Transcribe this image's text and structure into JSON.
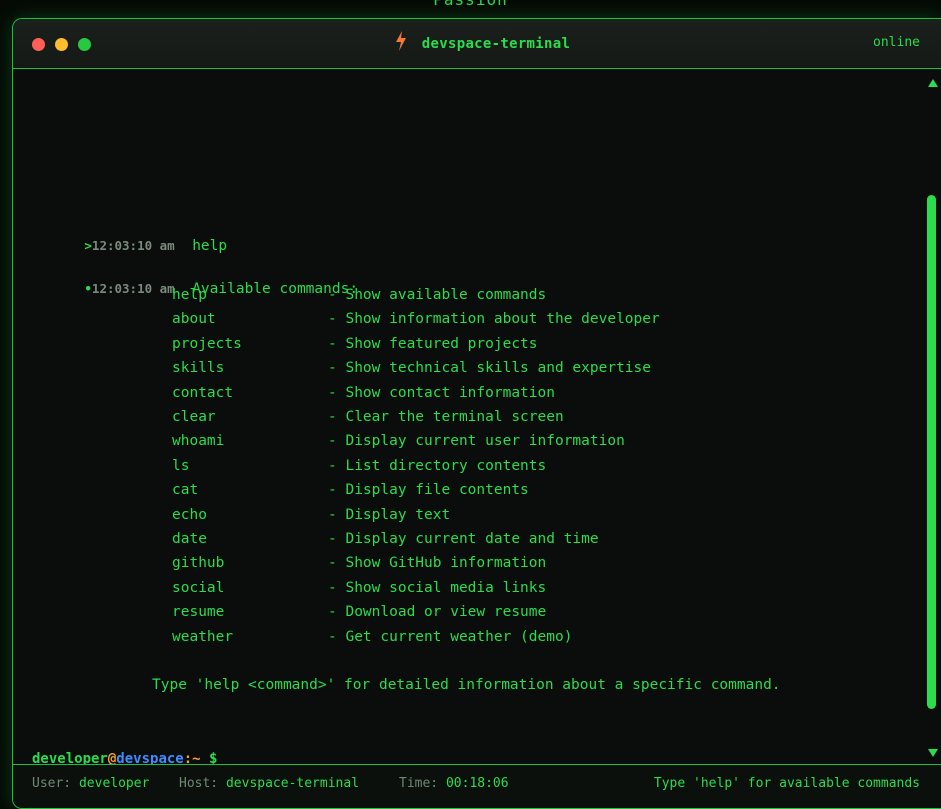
{
  "page": {
    "top_caption": "Passion"
  },
  "window": {
    "title": "devspace-terminal",
    "status": "online",
    "icon": "lightning-bolt-icon"
  },
  "terminal": {
    "entries": [
      {
        "marker": ">",
        "timestamp": "12:03:10 am",
        "text": "help"
      },
      {
        "marker": "•",
        "timestamp": "12:03:10 am",
        "text": "Available commands:"
      }
    ],
    "commands": [
      {
        "name": "help",
        "desc": "- Show available commands"
      },
      {
        "name": "about",
        "desc": "- Show information about the developer"
      },
      {
        "name": "projects",
        "desc": "- Show featured projects"
      },
      {
        "name": "skills",
        "desc": "- Show technical skills and expertise"
      },
      {
        "name": "contact",
        "desc": "- Show contact information"
      },
      {
        "name": "clear",
        "desc": "- Clear the terminal screen"
      },
      {
        "name": "whoami",
        "desc": "- Display current user information"
      },
      {
        "name": "ls",
        "desc": "- List directory contents"
      },
      {
        "name": "cat",
        "desc": "- Display file contents"
      },
      {
        "name": "echo",
        "desc": "- Display text"
      },
      {
        "name": "date",
        "desc": "- Display current date and time"
      },
      {
        "name": "github",
        "desc": "- Show GitHub information"
      },
      {
        "name": "social",
        "desc": "- Show social media links"
      },
      {
        "name": "resume",
        "desc": "- Download or view resume"
      },
      {
        "name": "weather",
        "desc": "- Get current weather (demo)"
      }
    ],
    "footer_hint": "Type 'help <command>' for detailed information about a specific command.",
    "prompt": {
      "user": "developer",
      "at": "@",
      "host": "devspace",
      "colon": ":",
      "dir": "~",
      "dollar": " $"
    }
  },
  "statusbar": {
    "user_label": "User:",
    "user_value": "developer",
    "host_label": "Host:",
    "host_value": "devspace-terminal",
    "time_label": "Time:",
    "time_value": "00:18:06",
    "hint": "Type 'help' for available commands"
  },
  "colors": {
    "accent": "#2bdc4c",
    "border": "#1fbf3e",
    "prompt_host": "#3d8cff",
    "prompt_symbol": "#f0a030",
    "dot_close": "#ff5f57",
    "dot_minimize": "#febc2e",
    "dot_maximize": "#28c840"
  }
}
